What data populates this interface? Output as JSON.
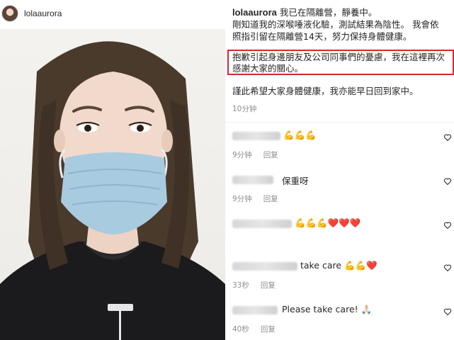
{
  "post": {
    "username": "lolaaurora"
  },
  "caption": {
    "username": "lolaaurora",
    "line1": "我已在隔離營，靜養中。",
    "line2": "剛知道我的深喉唾液化驗，測試結果為陰性。 我會依",
    "line3": "照指引留在隔離營14天，努力保持身體健康。",
    "highlight_line1": "抱歉引起身邊朋友及公司同事們的憂慮，我在這裡再次",
    "highlight_line2": "感謝大家的關心。",
    "closing": "謹此希望大家身體健康，我亦能早日回到家中。",
    "time": "10分钟"
  },
  "highlight_color": "#d9262c",
  "comments": [
    {
      "text": "💪💪💪",
      "time": "9分钟",
      "reply": "回复"
    },
    {
      "text": "保重呀",
      "time": "9分钟",
      "reply": "回复"
    },
    {
      "text": "💪💪💪❤️❤️❤️",
      "time": "",
      "reply": ""
    },
    {
      "text": "take care 💪💪❤️",
      "time": "33秒",
      "reply": "回复"
    },
    {
      "text": "Please take care! 🙏🏻",
      "time": "40秒",
      "reply": "回复"
    }
  ],
  "icons": {
    "like": "heart-outline-icon",
    "avatar": "avatar"
  }
}
